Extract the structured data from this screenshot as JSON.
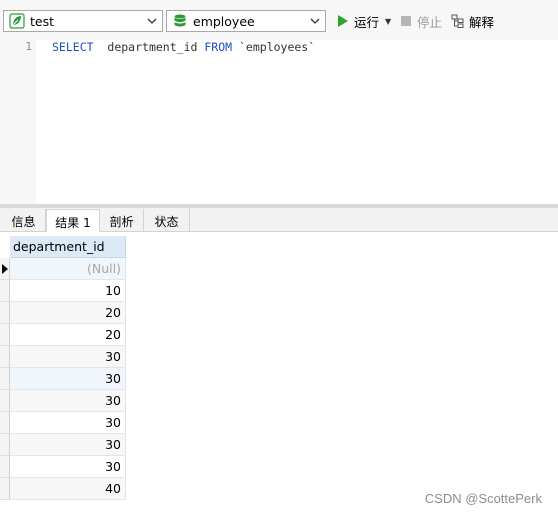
{
  "toolbar": {
    "connection": {
      "value": "test",
      "icon": "connection-leaf-icon"
    },
    "database": {
      "value": "employee",
      "icon": "database-icon"
    },
    "run_label": "运行",
    "stop_label": "停止",
    "explain_label": "解释"
  },
  "editor": {
    "line_numbers": [
      "1"
    ],
    "query": {
      "select_kw": "SELECT",
      "column": "department_id",
      "from_kw": "FROM",
      "table": "`employees`"
    }
  },
  "result_tabs": [
    {
      "label": "信息",
      "active": false
    },
    {
      "label": "结果 1",
      "active": true
    },
    {
      "label": "剖析",
      "active": false
    },
    {
      "label": "状态",
      "active": false
    }
  ],
  "grid": {
    "columns": [
      "department_id"
    ],
    "rows": [
      "(Null)",
      "10",
      "20",
      "20",
      "30",
      "30",
      "30",
      "30",
      "30",
      "30",
      "40"
    ]
  },
  "watermark": "CSDN @ScottePerk",
  "colors": {
    "keyword": "#1f4fc7",
    "run_green": "#2aa52a",
    "db_green": "#2e9a3a",
    "header_bg": "#dceaf8"
  }
}
